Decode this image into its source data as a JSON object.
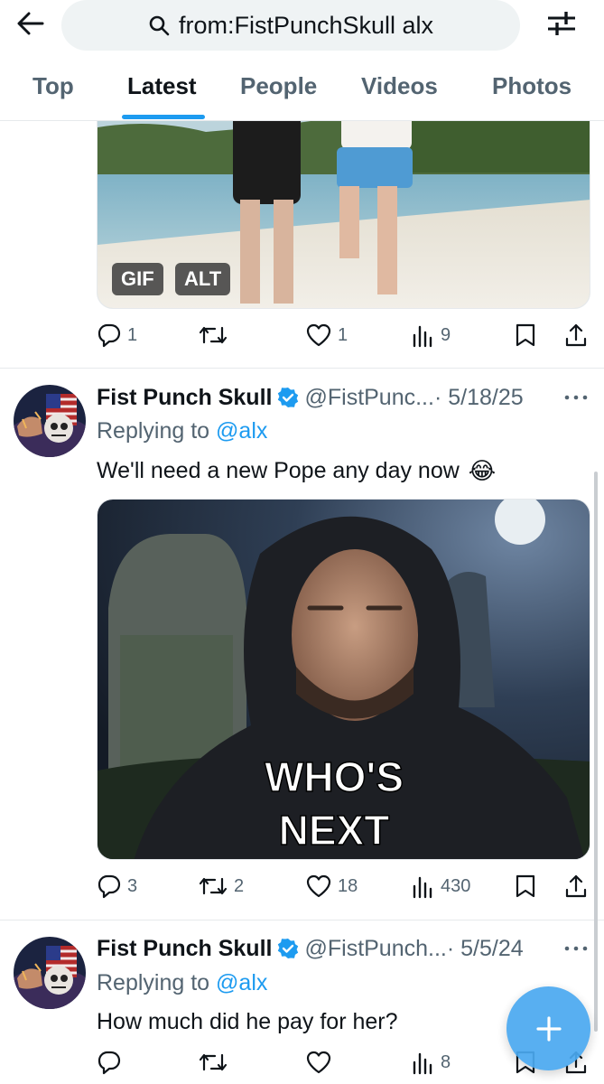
{
  "search": {
    "query": "from:FistPunchSkull alx"
  },
  "tabs": [
    {
      "label": "Top"
    },
    {
      "label": "Latest"
    },
    {
      "label": "People"
    },
    {
      "label": "Videos"
    },
    {
      "label": "Photos"
    }
  ],
  "active_tab": "Latest",
  "colors": {
    "accent": "#1d9bf0",
    "text": "#0f1419",
    "muted": "#536471",
    "fab": "#4aa9f0"
  },
  "first_tweet": {
    "media_badges": [
      "GIF",
      "ALT"
    ],
    "replies": "1",
    "retweets": "",
    "likes": "1",
    "views": "9"
  },
  "tweets": [
    {
      "name": "Fist Punch Skull",
      "handle": "@FistPunc...",
      "date": "· 5/18/25",
      "replying_prefix": "Replying to ",
      "replying_to": "@alx",
      "text": "We'll need a new Pope any day now",
      "emoji": "😂",
      "media_caption_line1": "WHO'S",
      "media_caption_line2": "NEXT",
      "replies": "3",
      "retweets": "2",
      "likes": "18",
      "views": "430"
    },
    {
      "name": "Fist Punch Skull",
      "handle": "@FistPunch...",
      "date": "· 5/5/24",
      "replying_prefix": "Replying to ",
      "replying_to": "@alx",
      "text": "How much did he pay for her?",
      "replies": "",
      "retweets": "",
      "likes": "",
      "views": "8"
    }
  ],
  "icons": [
    "back-arrow-icon",
    "search-icon",
    "filter-sliders-icon",
    "reply-icon",
    "retweet-icon",
    "like-icon",
    "views-icon",
    "bookmark-icon",
    "share-icon",
    "verified-badge-icon",
    "more-icon",
    "compose-plus-icon"
  ]
}
